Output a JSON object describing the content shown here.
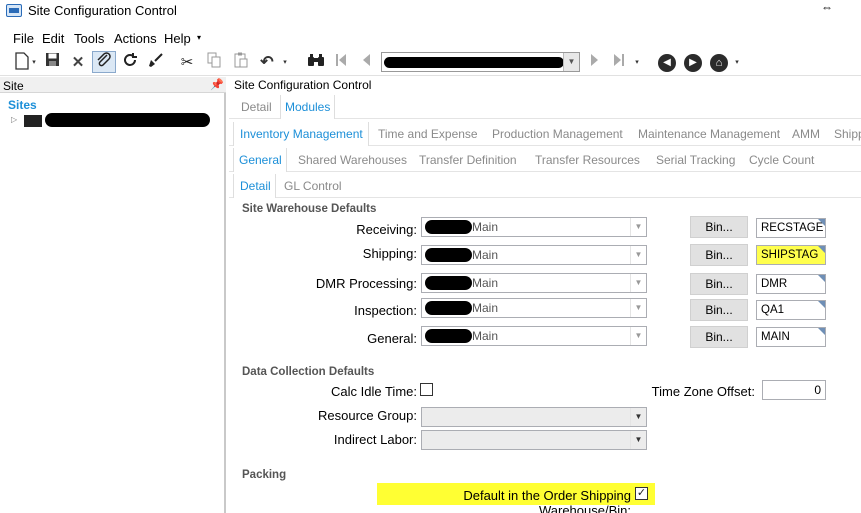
{
  "window": {
    "title": "Site Configuration Control",
    "resize_glyph": "⇔"
  },
  "menu": [
    "File",
    "Edit",
    "Tools",
    "Actions",
    "Help"
  ],
  "toolbar": {
    "icons": [
      "new-document-icon",
      "save-icon",
      "delete-icon",
      "attachment-icon",
      "refresh-icon",
      "clear-icon",
      "cut-icon",
      "copy-icon",
      "paste-icon",
      "undo-icon",
      "binoculars-icon",
      "first-record-icon",
      "previous-record-icon",
      "next-record-icon",
      "last-record-icon",
      "back-icon",
      "forward-icon",
      "home-icon"
    ]
  },
  "left_panel": {
    "header": "Site",
    "pin": "ᵖ",
    "tree_root": "Sites"
  },
  "right_panel": {
    "title": "Site Configuration Control",
    "tabs_level1": [
      "Detail",
      "Modules"
    ],
    "tabs_level2": [
      "Inventory Management",
      "Time and Expense",
      "Production Management",
      "Maintenance Management",
      "AMM",
      "Shipp"
    ],
    "tabs_level3": [
      "General",
      "Shared Warehouses",
      "Transfer Definition",
      "Transfer Resources",
      "Serial Tracking",
      "Cycle Count"
    ],
    "tabs_level4": [
      "Detail",
      "GL Control"
    ]
  },
  "site_warehouse_defaults": {
    "label": "Site Warehouse Defaults",
    "rows": [
      {
        "label": "Receiving:",
        "warehouse": "Main",
        "bin_button": "Bin...",
        "bin": "RECSTAGE",
        "highlight": false
      },
      {
        "label": "Shipping:",
        "warehouse": "Main",
        "bin_button": "Bin...",
        "bin": "SHIPSTAG",
        "highlight": true
      },
      {
        "label": "DMR Processing:",
        "warehouse": "Main",
        "bin_button": "Bin...",
        "bin": "DMR",
        "highlight": false
      },
      {
        "label": "Inspection:",
        "warehouse": "Main",
        "bin_button": "Bin...",
        "bin": "QA1",
        "highlight": false
      },
      {
        "label": "General:",
        "warehouse": "Main",
        "bin_button": "Bin...",
        "bin": "MAIN",
        "highlight": false
      }
    ]
  },
  "data_collection_defaults": {
    "label": "Data Collection Defaults",
    "calc_idle_time_label": "Calc Idle Time:",
    "calc_idle_time_checked": false,
    "time_zone_offset_label": "Time Zone Offset:",
    "time_zone_offset": "0",
    "resource_group_label": "Resource Group:",
    "resource_group": "",
    "indirect_labor_label": "Indirect Labor:",
    "indirect_labor": ""
  },
  "packing": {
    "label": "Packing",
    "default_order_shipping_label": "Default in the Order Shipping Warehouse/Bin:",
    "default_order_shipping_checked": true
  },
  "colors": {
    "accent": "#1c8fd8",
    "highlight": "#ffff33"
  }
}
